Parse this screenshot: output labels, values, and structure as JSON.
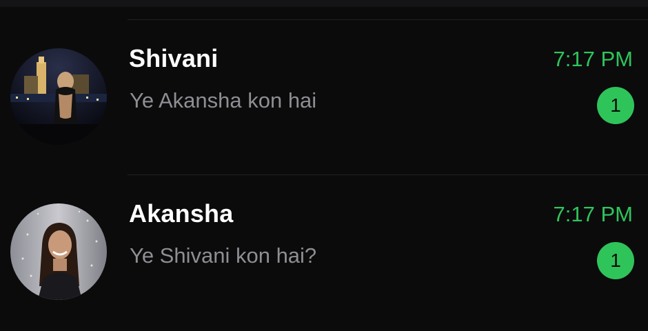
{
  "chats": [
    {
      "name": "Shivani",
      "preview": "Ye Akansha kon hai",
      "time": "7:17 PM",
      "unread": "1",
      "avatar": "profile-photo-city-night"
    },
    {
      "name": "Akansha",
      "preview": "Ye Shivani kon hai?",
      "time": "7:17 PM",
      "unread": "1",
      "avatar": "profile-photo-woman-lights"
    }
  ],
  "colors": {
    "background": "#0b0b0c",
    "accent_green": "#2fc45a",
    "name_text": "#ffffff",
    "preview_text": "#8e8e93"
  }
}
